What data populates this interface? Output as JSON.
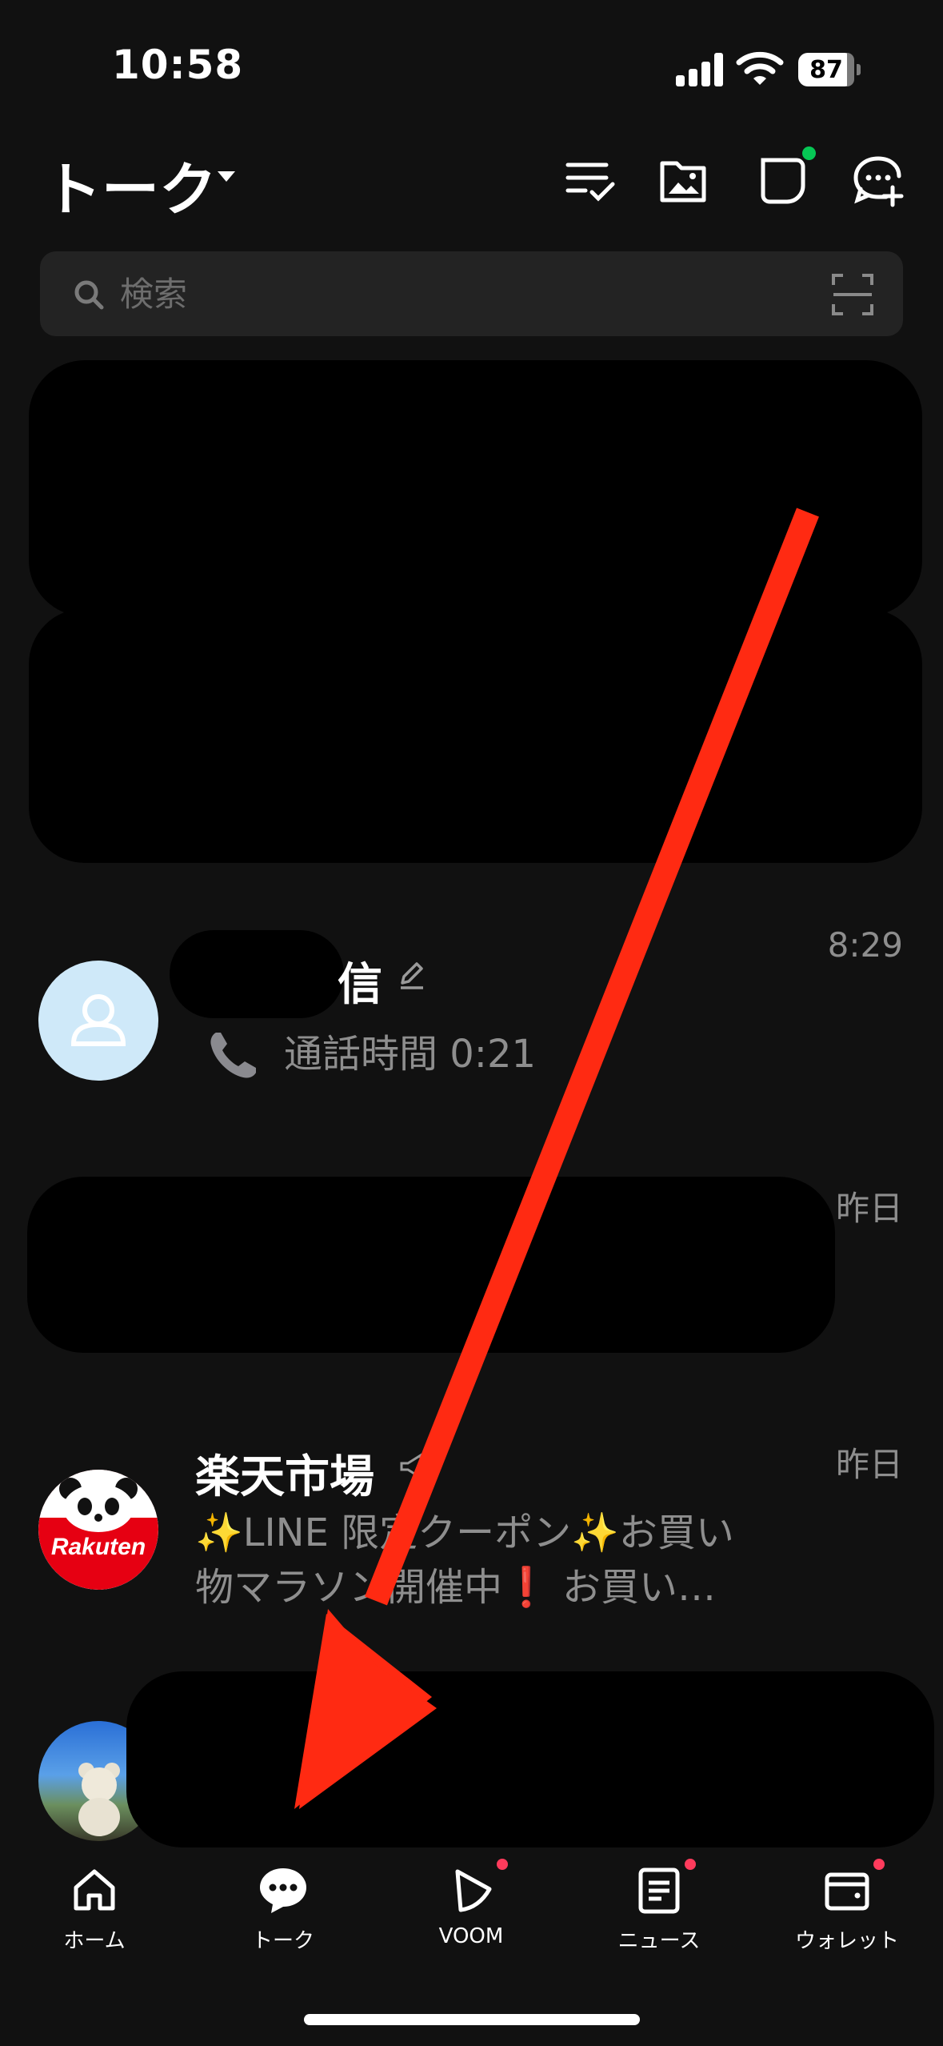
{
  "status_bar": {
    "time": "10:58",
    "battery": "87"
  },
  "header": {
    "title": "トーク"
  },
  "search": {
    "placeholder": "検索"
  },
  "chats": [
    {
      "name": "信",
      "message": "通話時間 0:21",
      "time": "8:29"
    },
    {
      "name": "",
      "message": "",
      "time": "昨日"
    },
    {
      "name": "楽天市場",
      "message_line1": "✨LINE 限定クーポン✨お買い",
      "message_line2": "物マラソン開催中❗ お買い…",
      "time": "昨日",
      "avatar_text": "Rakuten"
    }
  ],
  "tabs": [
    {
      "label": "ホーム"
    },
    {
      "label": "トーク"
    },
    {
      "label": "VOOM"
    },
    {
      "label": "ニュース"
    },
    {
      "label": "ウォレット"
    }
  ],
  "colors": {
    "accent_green": "#06c755",
    "badge_red": "#ff3b5c",
    "annotation_arrow": "#ff2a12"
  }
}
